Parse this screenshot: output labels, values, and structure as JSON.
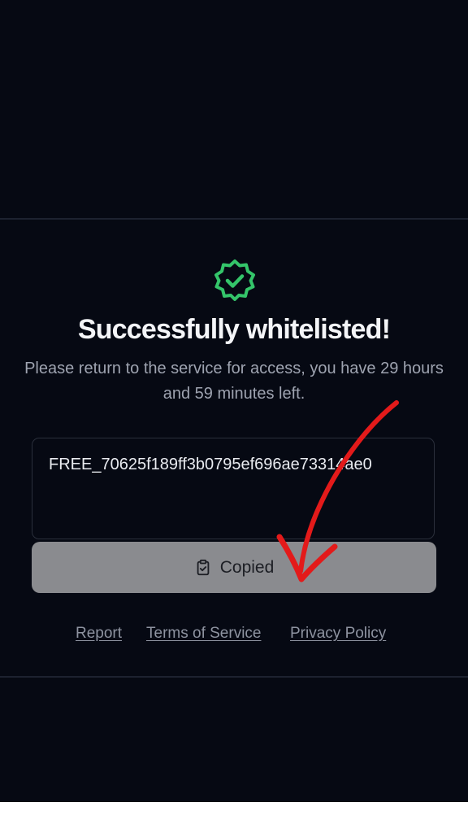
{
  "status": {
    "icon": "verified-badge-check-icon",
    "title": "Successfully whitelisted!",
    "message": "Please return to the service for access, you have 29 hours and 59 minutes left."
  },
  "key": {
    "value": "FREE_70625f189ff3b0795ef696ae73314ae0"
  },
  "copy_button": {
    "icon": "clipboard-check-icon",
    "label": "Copied"
  },
  "footer_links": {
    "report": "Report",
    "terms": "Terms of Service",
    "privacy": "Privacy Policy"
  },
  "annotation": {
    "icon": "red-arrow-annotation",
    "color": "#e31a1a"
  },
  "colors": {
    "background": "#060913",
    "success": "#34c56a",
    "button": "#8a8b8f"
  }
}
